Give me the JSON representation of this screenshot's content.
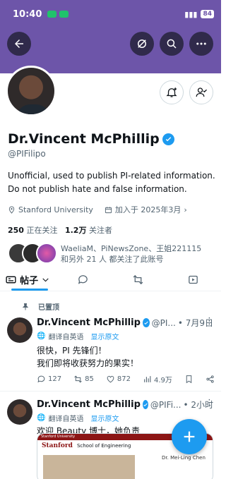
{
  "status_bar": {
    "time": "10:40",
    "battery": "84"
  },
  "profile": {
    "name": "Dr.Vincent McPhillip",
    "handle": "@PIFilipo",
    "bio": "Unofficial, used to publish PI-related information. Do not publish hate and false information.",
    "location": "Stanford University",
    "joined": "加入于 2025年3月",
    "following_count": "250",
    "following_label": "正在关注",
    "followers_count": "1.2万",
    "followers_label": "关注者",
    "followed_by_text": "WaeliaM、PiNewsZone、王姐221115 和另外 21 人 都关注了此账号"
  },
  "tabs": {
    "posts_label": "帖子"
  },
  "pinned_label": "已置顶",
  "tweets": [
    {
      "name": "Dr.Vincent McPhillip",
      "handle": "@PI...",
      "time": "• 7月9日",
      "translated_label": "翻译自英语",
      "show_original": "显示原文",
      "text": "很快，PI 先锋们！\n我们即将收获努力的果实！",
      "replies": "127",
      "reposts": "85",
      "likes": "872",
      "views": "4.9万"
    },
    {
      "name": "Dr.Vincent McPhillip",
      "handle": "@PIFi...",
      "time": "• 2小时",
      "translated_label": "翻译自英语",
      "show_original": "显示原文",
      "text": "欢迎 Beauty 博士，她负责 PINetw...领域的发展和研究！",
      "preview": {
        "top_bar": "Stanford University",
        "brand": "Stanford",
        "school": "School of Engineering",
        "caption": "Dr. Mei-Ling Chen"
      }
    }
  ],
  "colors": {
    "banner": "#6d55a9",
    "accent": "#1d9bf0",
    "verified": "#1d9bf0"
  },
  "icons": [
    "back-arrow-icon",
    "no-sync-icon",
    "search-icon",
    "more-icon",
    "bell-plus-icon",
    "person-check-icon",
    "pin-icon",
    "translate-icon",
    "reply-icon",
    "repost-icon",
    "like-icon",
    "views-icon",
    "bookmark-icon",
    "share-icon",
    "plus-icon"
  ]
}
